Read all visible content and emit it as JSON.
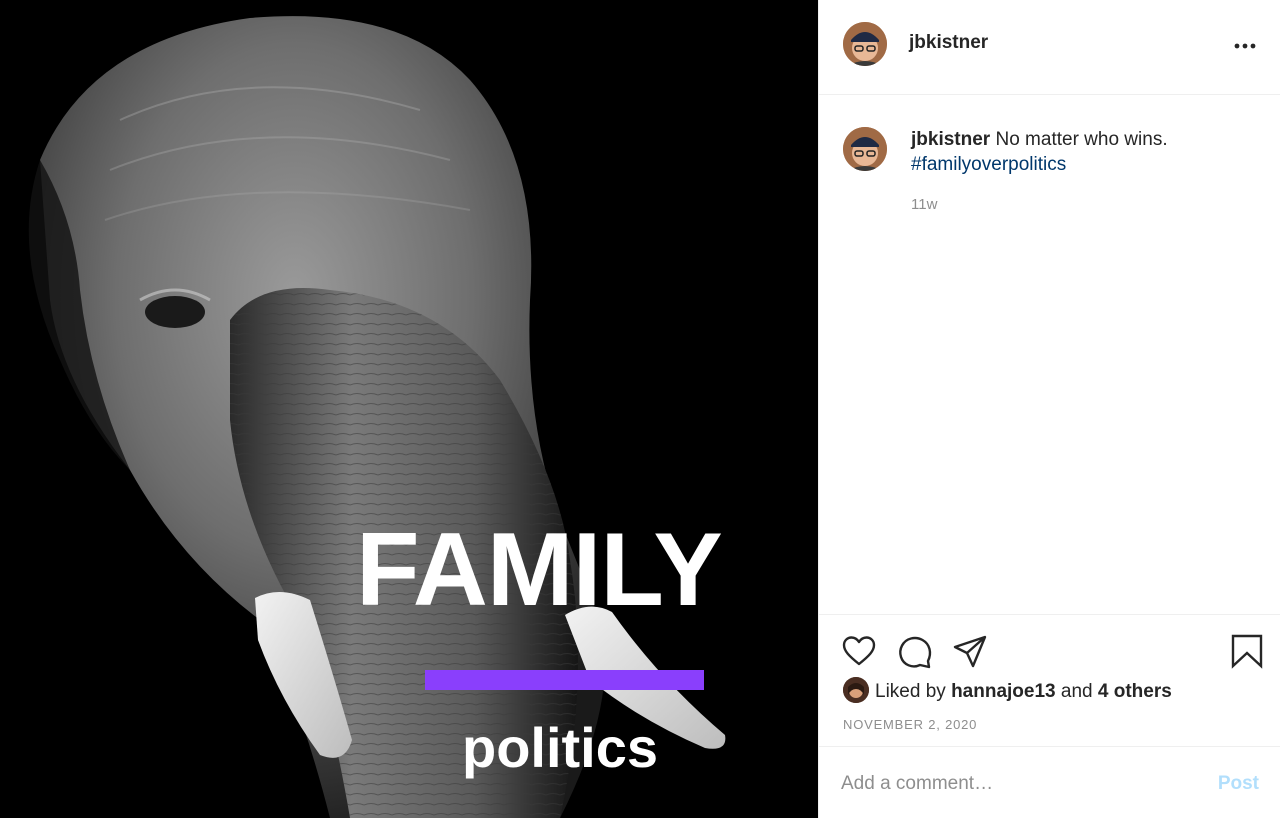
{
  "post": {
    "image": {
      "subject": "elephant-photo",
      "overlay_big_text": "FAMILY",
      "overlay_small_text": "politics",
      "accent_bar_color": "#8a3ffc"
    }
  },
  "header": {
    "username": "jbkistner",
    "more_icon": "more-horizontal-icon"
  },
  "caption": {
    "username": "jbkistner",
    "text": "No matter who wins.",
    "hashtag": "#familyoverpolitics",
    "time_ago": "11w"
  },
  "actions": {
    "icons": [
      "heart-icon",
      "comment-icon",
      "share-icon",
      "bookmark-icon"
    ]
  },
  "likes": {
    "prefix": "Liked by",
    "user": "hannajoe13",
    "and": "and",
    "others": "4 others"
  },
  "date": "NOVEMBER 2, 2020",
  "comment_box": {
    "placeholder": "Add a comment…",
    "post_label": "Post"
  },
  "colors": {
    "hashtag": "#00376b",
    "post_button_disabled": "#b2dffc",
    "muted_text": "#8e8e8e"
  }
}
